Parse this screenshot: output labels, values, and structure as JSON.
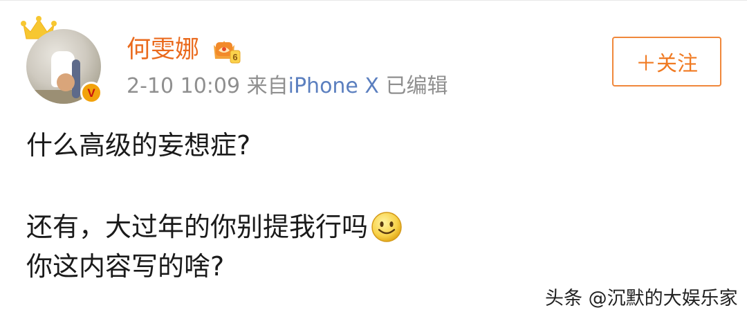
{
  "post": {
    "author": {
      "name": "何雯娜",
      "verified_badge": "V",
      "vip_level": "6",
      "crown_icon": "crown-icon",
      "badge_icon": "vip-crown-badge-icon"
    },
    "meta": {
      "timestamp": "2-10 10:09",
      "source_prefix": "来自",
      "device": "iPhone X",
      "edited": "已编辑"
    },
    "follow_button": {
      "label": "＋关注"
    },
    "content": {
      "line1": "什么高级的妄想症?",
      "line2": "还有，大过年的你别提我行吗",
      "line2_emoji": "smiley-icon",
      "line3": "你这内容写的啥?"
    },
    "watermark": "头条 @沉默的大娱乐家"
  },
  "colors": {
    "username": "#ea6a1d",
    "meta_text": "#8f8f8f",
    "device_link": "#5b7fbf",
    "follow_border": "#f0873a",
    "follow_text": "#f07a22",
    "crown": "#f7c731",
    "verified_badge": "#f2a20c"
  }
}
